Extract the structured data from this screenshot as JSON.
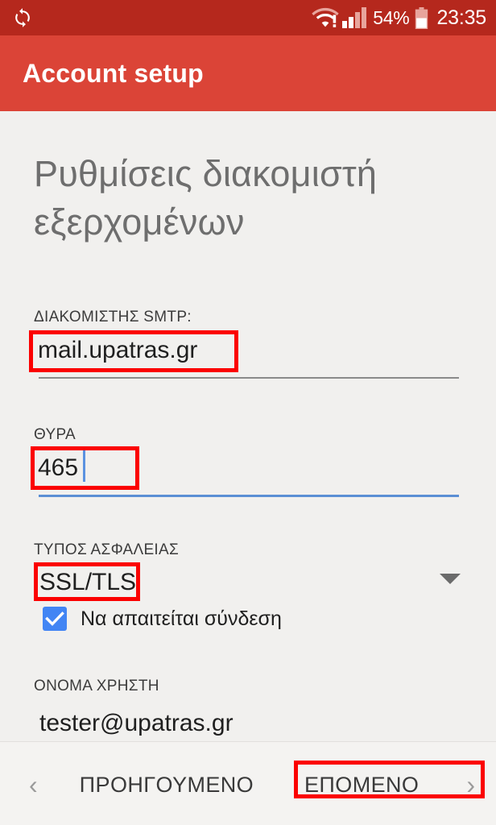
{
  "status_bar": {
    "sync_icon": "sync-icon",
    "wifi_icon": "wifi-warning-icon",
    "signal_icon": "cellular-signal-icon",
    "battery_percent": "54%",
    "battery_icon": "battery-half-icon",
    "time": "23:35",
    "background_color": "#b5281d"
  },
  "app_bar": {
    "title": "Account setup",
    "background_color": "#db4437"
  },
  "main": {
    "heading": "Ρυθμίσεις διακομιστή εξερχομένων",
    "fields": [
      {
        "label": "ΔΙΑΚΟΜΙΣΤΗΣ SMTP:",
        "value": "mail.upatras.gr",
        "focused": false,
        "highlighted": true
      },
      {
        "label": "ΘΥΡΑ",
        "value": "465",
        "focused": true,
        "highlighted": true
      },
      {
        "label": "ΤΥΠΟΣ ΑΣΦΑΛΕΙΑΣ",
        "value": "SSL/TLS",
        "focused": false,
        "highlighted": true
      },
      {
        "label": "ΟΝΟΜΑ ΧΡΗΣΤΗ",
        "value": "tester@upatras.gr",
        "focused": false,
        "highlighted": false
      }
    ],
    "checkbox": {
      "label": "Να απαιτείται σύνδεση",
      "checked": true,
      "color": "#4285f4"
    },
    "dropdown_icon": "chevron-down-icon"
  },
  "bottom_bar": {
    "previous": {
      "label": "ΠΡΟΗΓΟΥΜΕΝΟ",
      "icon": "chevron-left-icon",
      "highlighted": false
    },
    "next": {
      "label": "ΕΠΟΜΕΝΟ",
      "icon": "chevron-right-icon",
      "highlighted": true
    }
  },
  "annotation": {
    "color": "#fb0000"
  }
}
